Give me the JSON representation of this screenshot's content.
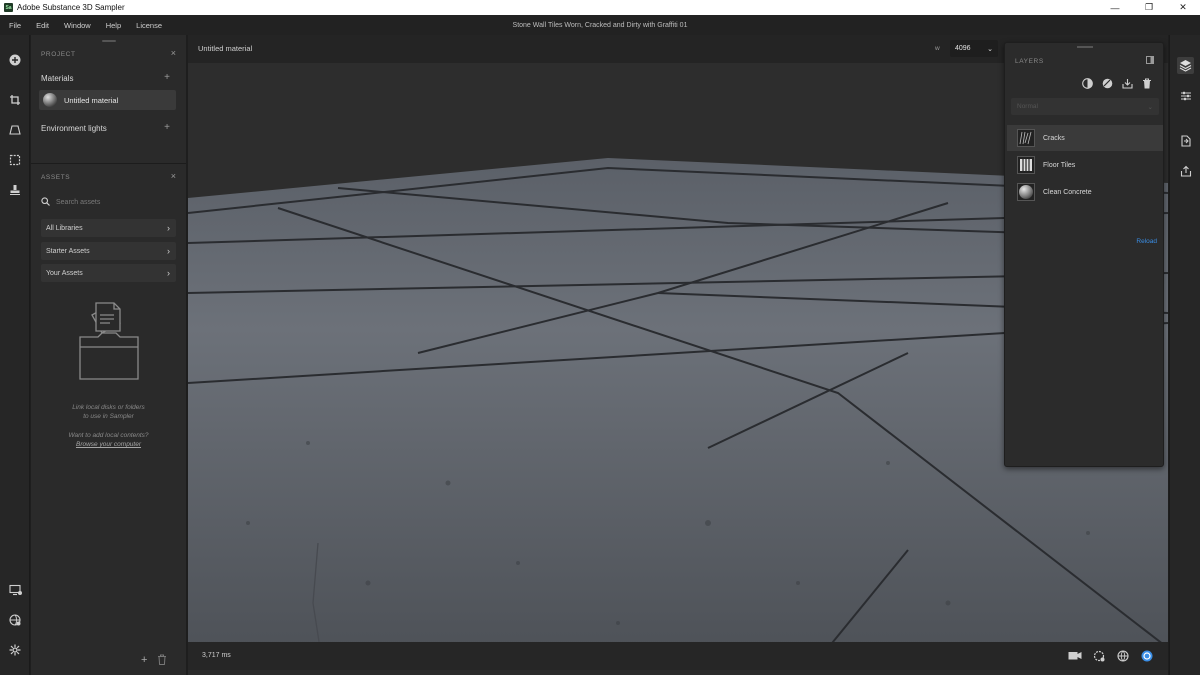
{
  "window": {
    "app_title": "Adobe Substance 3D Sampler",
    "app_badge": "Sa",
    "document_title": "Stone Wall Tiles Worn, Cracked and Dirty with Graffiti 01",
    "controls": {
      "minimize": "—",
      "maximize": "❐",
      "close": "✕"
    }
  },
  "menu": [
    "File",
    "Edit",
    "Window",
    "Help",
    "License"
  ],
  "left_toolbar": {
    "top_icons": [
      "add-icon",
      "crop-icon",
      "perspective-icon",
      "select-area-icon",
      "stamp-icon"
    ],
    "bottom_icons": [
      "display-settings-icon",
      "environment-icon",
      "settings-icon"
    ]
  },
  "project": {
    "header": "PROJECT",
    "close": "×",
    "materials_label": "Materials",
    "add": "+",
    "material_item": "Untitled material",
    "env_lights_label": "Environment lights"
  },
  "assets": {
    "header": "ASSETS",
    "close": "×",
    "search_placeholder": "Search assets",
    "libraries": [
      "All Libraries",
      "Starter Assets",
      "Your Assets"
    ],
    "chevron": "›",
    "hint_line1": "Link local disks or folders",
    "hint_line2": "to use in Sampler",
    "hint_line3": "Want to add local contents?",
    "hint_link": "Browse your computer",
    "add": "+",
    "delete_icon": "trash-icon"
  },
  "viewport": {
    "material_name": "Untitled material",
    "resolution_label": "w",
    "resolution_value": "4096",
    "chevron": "⌄",
    "render_time": "3,717 ms",
    "status_icons": [
      "camera-icon",
      "lighting-icon",
      "environment-icon",
      "render-icon"
    ]
  },
  "layers": {
    "header": "LAYERS",
    "blend_mode": "Normal",
    "items": [
      {
        "label": "Cracks",
        "thumb": "cracks-thumb",
        "selected": true
      },
      {
        "label": "Floor Tiles",
        "thumb": "tiles-thumb",
        "selected": false
      },
      {
        "label": "Clean Concrete",
        "thumb": "concrete-thumb",
        "selected": false
      }
    ],
    "reload": "Reload",
    "actions": [
      "mask-icon",
      "fill-icon",
      "export-icon",
      "trash-icon"
    ]
  },
  "right_toolbar": [
    "layers-icon",
    "properties-icon",
    "export-doc-icon",
    "share-icon"
  ],
  "colors": {
    "accent": "#3a8ee6",
    "panel": "#2a2a2a",
    "background": "#1e1e1e"
  }
}
